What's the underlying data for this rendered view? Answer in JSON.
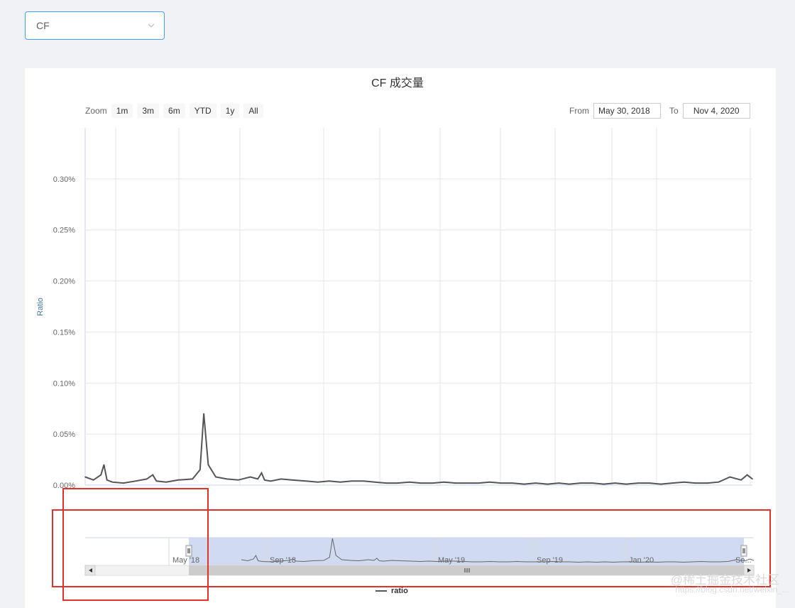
{
  "selector": {
    "value": "CF",
    "icon": "chevron-down-icon"
  },
  "chart_data": {
    "type": "line",
    "title": "CF 成交量",
    "ylabel": "Ratio",
    "yticks": [
      "0.00%",
      "0.05%",
      "0.10%",
      "0.15%",
      "0.20%",
      "0.25%",
      "0.30%"
    ],
    "ylim": [
      0,
      0.0035
    ],
    "xlim": [
      "2018-05-30",
      "2020-11-04"
    ],
    "grid": true,
    "legend_position": "bottom-center",
    "series": [
      {
        "name": "ratio",
        "color": "#555555",
        "x": [
          "2018-05-30",
          "2018-06-10",
          "2018-06-20",
          "2018-06-24",
          "2018-06-28",
          "2018-07-05",
          "2018-07-20",
          "2018-08-05",
          "2018-08-20",
          "2018-08-28",
          "2018-09-02",
          "2018-09-15",
          "2018-10-01",
          "2018-10-20",
          "2018-10-30",
          "2018-11-04",
          "2018-11-10",
          "2018-11-20",
          "2018-12-05",
          "2018-12-20",
          "2019-01-05",
          "2019-01-15",
          "2019-01-20",
          "2019-01-24",
          "2019-02-01",
          "2019-02-15",
          "2019-03-01",
          "2019-03-20",
          "2019-04-05",
          "2019-04-20",
          "2019-05-05",
          "2019-05-20",
          "2019-06-05",
          "2019-06-20",
          "2019-07-05",
          "2019-07-20",
          "2019-08-05",
          "2019-08-20",
          "2019-09-05",
          "2019-09-20",
          "2019-10-05",
          "2019-10-20",
          "2019-11-05",
          "2019-11-20",
          "2019-12-05",
          "2019-12-20",
          "2020-01-05",
          "2020-01-20",
          "2020-02-05",
          "2020-02-20",
          "2020-03-05",
          "2020-03-20",
          "2020-04-05",
          "2020-04-20",
          "2020-05-05",
          "2020-05-20",
          "2020-06-05",
          "2020-06-20",
          "2020-07-05",
          "2020-07-20",
          "2020-08-05",
          "2020-08-20",
          "2020-09-05",
          "2020-09-20",
          "2020-10-05",
          "2020-10-20",
          "2020-10-28",
          "2020-11-04"
        ],
        "values": [
          8e-05,
          5e-05,
          0.0001,
          0.0002,
          5e-05,
          3e-05,
          2e-05,
          4e-05,
          6e-05,
          0.0001,
          4e-05,
          3e-05,
          5e-05,
          6e-05,
          0.00015,
          0.0007,
          0.0002,
          8e-05,
          6e-05,
          5e-05,
          8e-05,
          6e-05,
          0.00012,
          5e-05,
          4e-05,
          6e-05,
          5e-05,
          4e-05,
          3e-05,
          4e-05,
          3e-05,
          4e-05,
          4e-05,
          3e-05,
          2e-05,
          2e-05,
          3e-05,
          2e-05,
          2e-05,
          3e-05,
          2e-05,
          2e-05,
          2e-05,
          3e-05,
          2e-05,
          2e-05,
          1e-05,
          2e-05,
          1e-05,
          2e-05,
          1e-05,
          2e-05,
          2e-05,
          1e-05,
          2e-05,
          1e-05,
          2e-05,
          2e-05,
          1e-05,
          2e-05,
          3e-05,
          2e-05,
          2e-05,
          3e-05,
          8e-05,
          5e-05,
          0.0001,
          6e-05
        ]
      }
    ]
  },
  "toolbar": {
    "zoom_label": "Zoom",
    "zoom_buttons": [
      "1m",
      "3m",
      "6m",
      "YTD",
      "1y",
      "All"
    ],
    "from_label": "From",
    "from_value": "May 30, 2018",
    "to_label": "To",
    "to_value": "Nov 4, 2020"
  },
  "navigator": {
    "labels": [
      "May '18",
      "Sep '18",
      "May '19",
      "Sep '19",
      "Jan '20",
      "Se..."
    ],
    "scroll_left_icon": "arrow-left-icon",
    "scroll_right_icon": "arrow-right-icon",
    "grip_icon": "grip-icon"
  },
  "legend": {
    "label": "ratio"
  },
  "watermark": {
    "text": "@稀土掘金技术社区",
    "url": "https://blog.csdn.net/weixin_..."
  },
  "colors": {
    "accent": "#409eff",
    "navigator_mask": "#c8d3ef",
    "red_annotation": "#e0312b"
  }
}
